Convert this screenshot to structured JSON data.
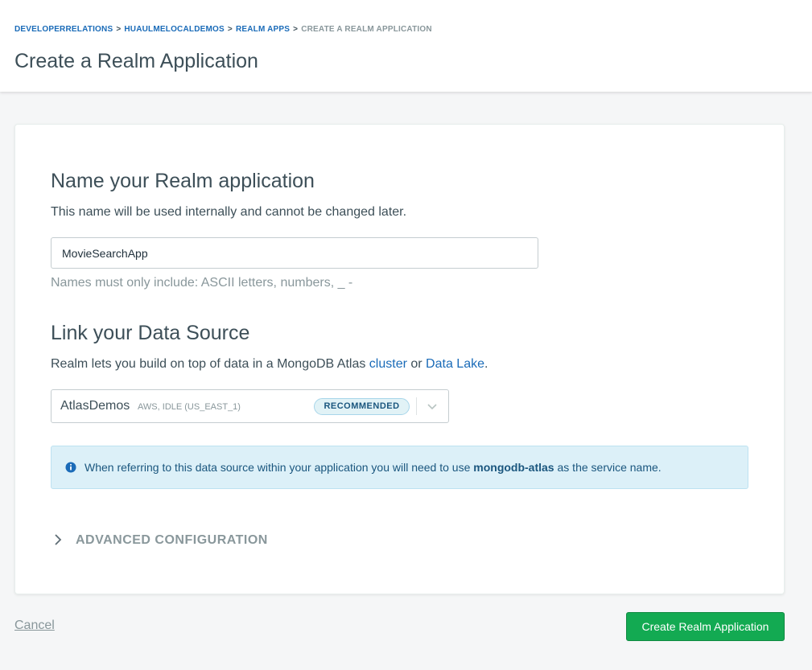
{
  "breadcrumb": {
    "items": [
      "DEVELOPERRELATIONS",
      "HUAULMELOCALDEMOS",
      "REALM APPS"
    ],
    "separator": ">",
    "current": "CREATE A REALM APPLICATION"
  },
  "page": {
    "title": "Create a Realm Application"
  },
  "name_section": {
    "title": "Name your Realm application",
    "description": "This name will be used internally and cannot be changed later.",
    "input_value": "MovieSearchApp",
    "hint": "Names must only include: ASCII letters, numbers, _ -"
  },
  "data_source_section": {
    "title": "Link your Data Source",
    "description_pre": "Realm lets you build on top of data in a MongoDB Atlas ",
    "link_cluster": "cluster",
    "description_mid": " or ",
    "link_datalake": "Data Lake",
    "description_post": ".",
    "selected_name": "AtlasDemos",
    "selected_meta": "AWS, IDLE (US_EAST_1)",
    "badge": "RECOMMENDED"
  },
  "info": {
    "text_pre": "When referring to this data source within your application you will need to use ",
    "service_name": "mongodb-atlas",
    "text_post": " as the service name."
  },
  "advanced": {
    "label": "ADVANCED CONFIGURATION"
  },
  "footer": {
    "cancel_label": "Cancel",
    "create_label": "Create Realm Application"
  },
  "colors": {
    "link": "#1a6bb8",
    "primary_button": "#13aa52",
    "info_bg": "#dcf0f8"
  }
}
